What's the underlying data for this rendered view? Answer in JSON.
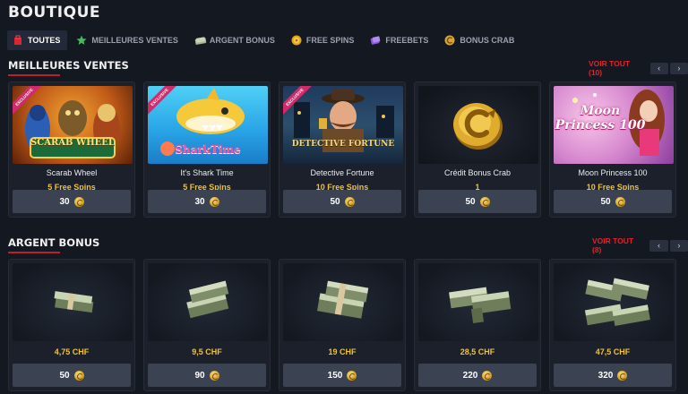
{
  "page": {
    "title": "BOUTIQUE"
  },
  "tabs": [
    {
      "label": "TOUTES",
      "icon": "shop-icon",
      "active": true
    },
    {
      "label": "MEILLEURES VENTES",
      "icon": "star-icon",
      "active": false
    },
    {
      "label": "ARGENT BONUS",
      "icon": "cash-icon",
      "active": false
    },
    {
      "label": "FREE SPINS",
      "icon": "free-spins-icon",
      "active": false
    },
    {
      "label": "FREEBETS",
      "icon": "freebets-icon",
      "active": false
    },
    {
      "label": "BONUS CRAB",
      "icon": "crab-coin-icon",
      "active": false
    }
  ],
  "sections": {
    "best_sellers": {
      "title": "MEILLEURES VENTES",
      "see_all": "VOIR TOUT (10)",
      "items": [
        {
          "name": "Scarab Wheel",
          "subtitle": "5 Free Spins",
          "price": "30",
          "badge": "EXCLUSIVE",
          "art_text": "SCARAB WHEEL"
        },
        {
          "name": "It's Shark Time",
          "subtitle": "5 Free Spins",
          "price": "30",
          "badge": "EXCLUSIVE",
          "art_text": "SharkTime"
        },
        {
          "name": "Detective Fortune",
          "subtitle": "10 Free Spins",
          "price": "50",
          "badge": "EXCLUSIVE",
          "art_text": "DETECTIVE FORTUNE"
        },
        {
          "name": "Crédit Bonus Crab",
          "subtitle": "1",
          "price": "50",
          "badge": "",
          "art_text": ""
        },
        {
          "name": "Moon Princess 100",
          "subtitle": "10 Free Spins",
          "price": "50",
          "badge": "",
          "art_text": "Moon Princess 100"
        }
      ]
    },
    "bonus_money": {
      "title": "ARGENT BONUS",
      "see_all": "VOIR TOUT (8)",
      "items": [
        {
          "amount": "4,75 CHF",
          "price": "50"
        },
        {
          "amount": "9,5 CHF",
          "price": "90"
        },
        {
          "amount": "19 CHF",
          "price": "150"
        },
        {
          "amount": "28,5 CHF",
          "price": "220"
        },
        {
          "amount": "47,5 CHF",
          "price": "320"
        }
      ]
    }
  },
  "colors": {
    "background": "#141821",
    "accent_red": "#d9262f",
    "gold": "#f0c23a",
    "card": "#1b202b"
  }
}
